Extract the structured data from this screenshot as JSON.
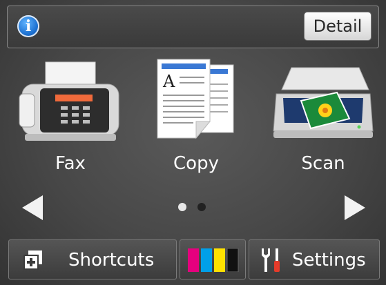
{
  "topbar": {
    "info_label": "i",
    "detail_label": "Detail"
  },
  "tiles": [
    {
      "label": "Fax",
      "icon": "fax-icon"
    },
    {
      "label": "Copy",
      "icon": "copy-icon"
    },
    {
      "label": "Scan",
      "icon": "scan-icon"
    }
  ],
  "pager": {
    "current_page": 1,
    "total_pages": 2
  },
  "bottom": {
    "shortcuts_label": "Shortcuts",
    "settings_label": "Settings",
    "ink_colors": [
      "#e6007e",
      "#00a0e9",
      "#ffe100",
      "#111111"
    ]
  }
}
